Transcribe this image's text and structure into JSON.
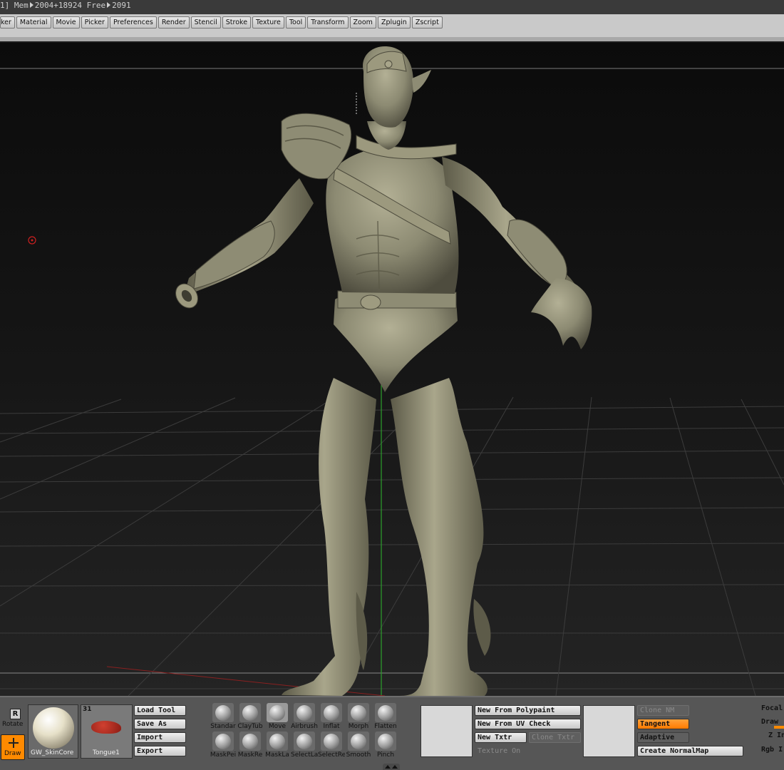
{
  "titlebar": {
    "left": "1]",
    "mem_label": "Mem",
    "mem_value": "2004+18924",
    "free_label": "Free",
    "free_value": "2091"
  },
  "menu": {
    "items": [
      "ker",
      "Material",
      "Movie",
      "Picker",
      "Preferences",
      "Render",
      "Stencil",
      "Stroke",
      "Texture",
      "Tool",
      "Transform",
      "Zoom",
      "Zplugin",
      "Zscript"
    ]
  },
  "left_tools": {
    "rotate_label": "Rotate",
    "draw_label": "Draw",
    "rotate_badge": "R"
  },
  "material": {
    "name": "GW_SkinCore"
  },
  "tool": {
    "name": "Tongue1",
    "count": "31"
  },
  "tool_buttons": {
    "load": "Load Tool",
    "save": "Save As",
    "import": "Import",
    "export": "Export"
  },
  "brushes_top": [
    "Standar",
    "ClayTub",
    "Move",
    "Airbrush",
    "Inflat",
    "Morph",
    "Flatten"
  ],
  "brushes_bottom": [
    "MaskPei",
    "MaskRe",
    "MaskLa",
    "SelectLa",
    "SelectRe",
    "Smooth",
    "Pinch"
  ],
  "normal_map": {
    "new_from_polypaint": "New From Polypaint",
    "new_from_uv_check": "New From UV Check",
    "new_txtr": "New Txtr",
    "clone_txtr": "Clone Txtr",
    "texture_on": "Texture On",
    "clone_nm": "Clone NM",
    "tangent": "Tangent",
    "adaptive": "Adaptive",
    "create_normalmap": "Create NormalMap"
  },
  "right_panel": {
    "focal": "Focal",
    "draw": "Draw",
    "z_in": "Z In",
    "rgb": "Rgb I"
  },
  "colors": {
    "accent": "#ff8a00",
    "viewport_bg": "#111111",
    "menubar_bg": "#c9c9c9",
    "shelf_bg": "#565656",
    "model": "#8c8a72"
  }
}
